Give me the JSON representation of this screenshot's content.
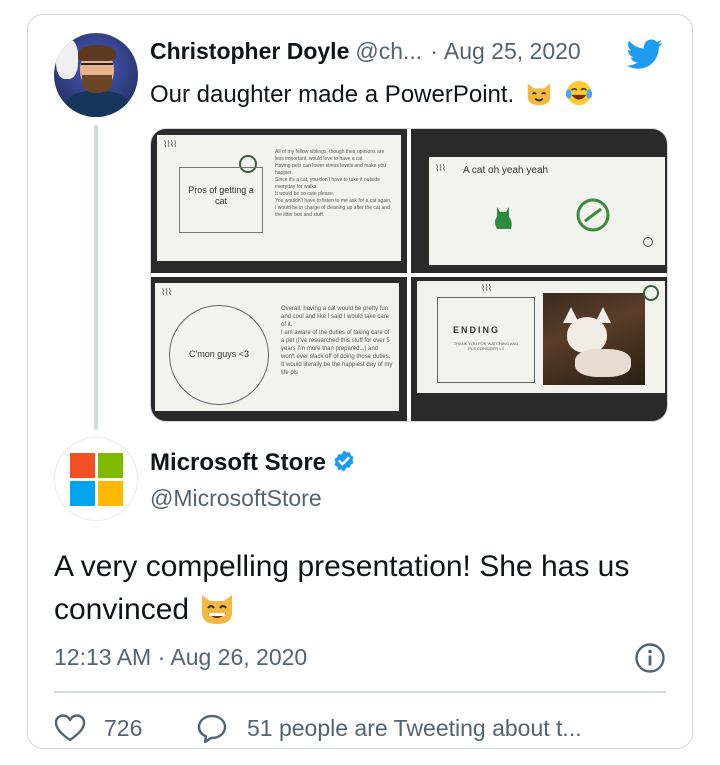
{
  "original_tweet": {
    "author_name": "Christopher Doyle",
    "author_handle": "@ch...",
    "separator": "·",
    "date": "Aug 25, 2020",
    "text": "Our daughter made a PowerPoint.",
    "emojis": [
      "cat-face-emoji",
      "laughing-tears-emoji"
    ],
    "media": {
      "slide1": {
        "title": "Pros of getting a cat",
        "bullets": [
          "All of my fellow siblings, though their opinions are less important, would love to have a cat",
          "Having pets can lower stress levels and make you happier.",
          "Since it's a cat, you don't have to take it outside everyday for walks.",
          "It would be so cute please.",
          "You wouldn't have to listen to me ask for a cat again.",
          "I would be in charge of cleaning up after the cat and the litter box and stuff."
        ]
      },
      "slide2": {
        "title": "A cat oh yeah yeah"
      },
      "slide3": {
        "title": "C'mon guys <3",
        "bullets": [
          "Overall, having a cat would be pretty fun and cool and like I said I would take care of it.",
          "I am aware of the duties of taking care of a pet (I've researched this stuff for over 5 years I'm more than prepared...) and won't ever slack off of doing those duties.",
          "It would literally be the happiest day of my life pls"
        ]
      },
      "slide4": {
        "title": "ENDING",
        "subtitle": "THANK YOU FOR WATCHING AND PLS CONSIDER <3"
      }
    }
  },
  "reply_tweet": {
    "author_name": "Microsoft Store",
    "author_handle": "@MicrosoftStore",
    "text": "A very compelling presentation! She has us convinced",
    "emoji": "grinning-cat-emoji",
    "timestamp": "12:13 AM · Aug 26, 2020",
    "likes": "726",
    "replies_text": "51 people are Tweeting about t...",
    "colors": {
      "verified": "#1d9bf0",
      "twitter_blue": "#1d9bf0"
    },
    "logo_colors": [
      "#f25022",
      "#7fba00",
      "#00a4ef",
      "#ffb900"
    ]
  }
}
